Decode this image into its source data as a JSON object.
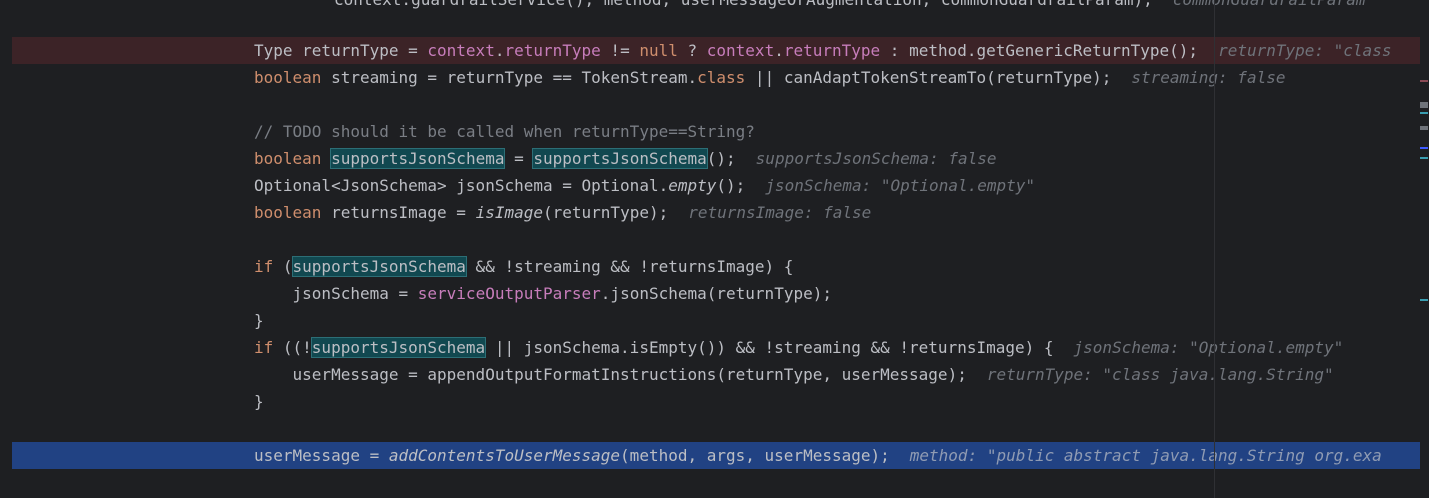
{
  "lines": {
    "l0": "context.guardrailService(), method, userMessageOrAugmentation, commonGuardrailParam);",
    "l0_hint": "commonGuardrailParam",
    "l1_hint": "returnType: \"class",
    "l2_hint": "streaming: false",
    "l3_comment": "// TODO should it be called when returnType==String?",
    "l4_hint": "supportsJsonSchema: false",
    "l5_hint": "jsonSchema: \"Optional.empty\"",
    "l6_hint": "returnsImage: false",
    "l11_hint": "jsonSchema: \"Optional.empty\"",
    "l12_hint": "returnType: \"class java.lang.String\"",
    "l14_hint": "method: \"public abstract java.lang.String org.exa"
  },
  "colors": {
    "background": "#1e1f22",
    "breakpoint_line": "#3c2327",
    "execution_line": "#214283",
    "keyword": "#cf8e6d",
    "field": "#c77dbb",
    "highlight": "#114850"
  }
}
